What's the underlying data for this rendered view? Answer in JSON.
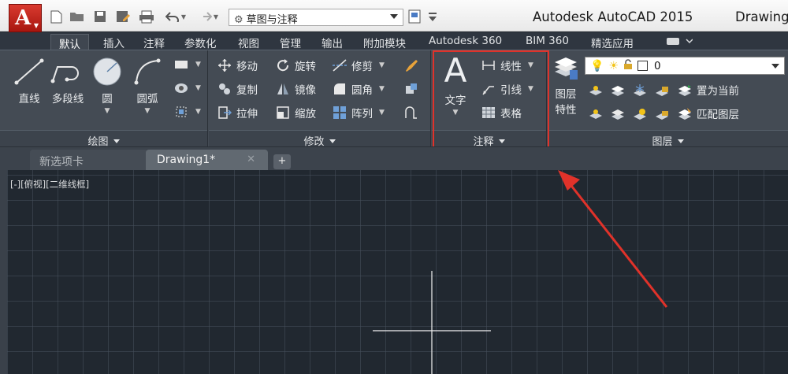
{
  "title_bar": {
    "app_title": "Autodesk AutoCAD 2015",
    "drawing_title": "Drawing",
    "logo_letter": "A",
    "workspace": "草图与注释",
    "quick_access_icons": [
      "new-icon",
      "open-icon",
      "save-icon",
      "save-as-icon",
      "plot-icon",
      "undo-icon",
      "redo-icon"
    ]
  },
  "menu_tabs": [
    "默认",
    "插入",
    "注释",
    "参数化",
    "视图",
    "管理",
    "输出",
    "附加模块",
    "Autodesk 360",
    "BIM 360",
    "精选应用"
  ],
  "ribbon": {
    "draw": {
      "title": "绘图",
      "items": [
        "直线",
        "多段线",
        "圆",
        "圆弧"
      ]
    },
    "modify": {
      "title": "修改",
      "rows": [
        [
          "移动",
          "旋转",
          "修剪"
        ],
        [
          "复制",
          "镜像",
          "圆角"
        ],
        [
          "拉伸",
          "缩放",
          "阵列"
        ]
      ]
    },
    "annotation": {
      "title": "注释",
      "text_label": "文字",
      "items": [
        "线性",
        "引线",
        "表格"
      ]
    },
    "layers": {
      "title": "图层",
      "properties_label_1": "图层",
      "properties_label_2": "特性",
      "current_layer": "0",
      "set_current": "置为当前",
      "match_layer": "匹配图层"
    }
  },
  "file_tabs": {
    "start": "新选项卡",
    "drawing": "Drawing1*",
    "close": "✕",
    "add": "+"
  },
  "viewport": {
    "label": "[-][俯视][二维线框]"
  },
  "colors": {
    "accent": "#e0322a",
    "ribbon_bg": "#444b54",
    "canvas_bg": "#212830"
  }
}
